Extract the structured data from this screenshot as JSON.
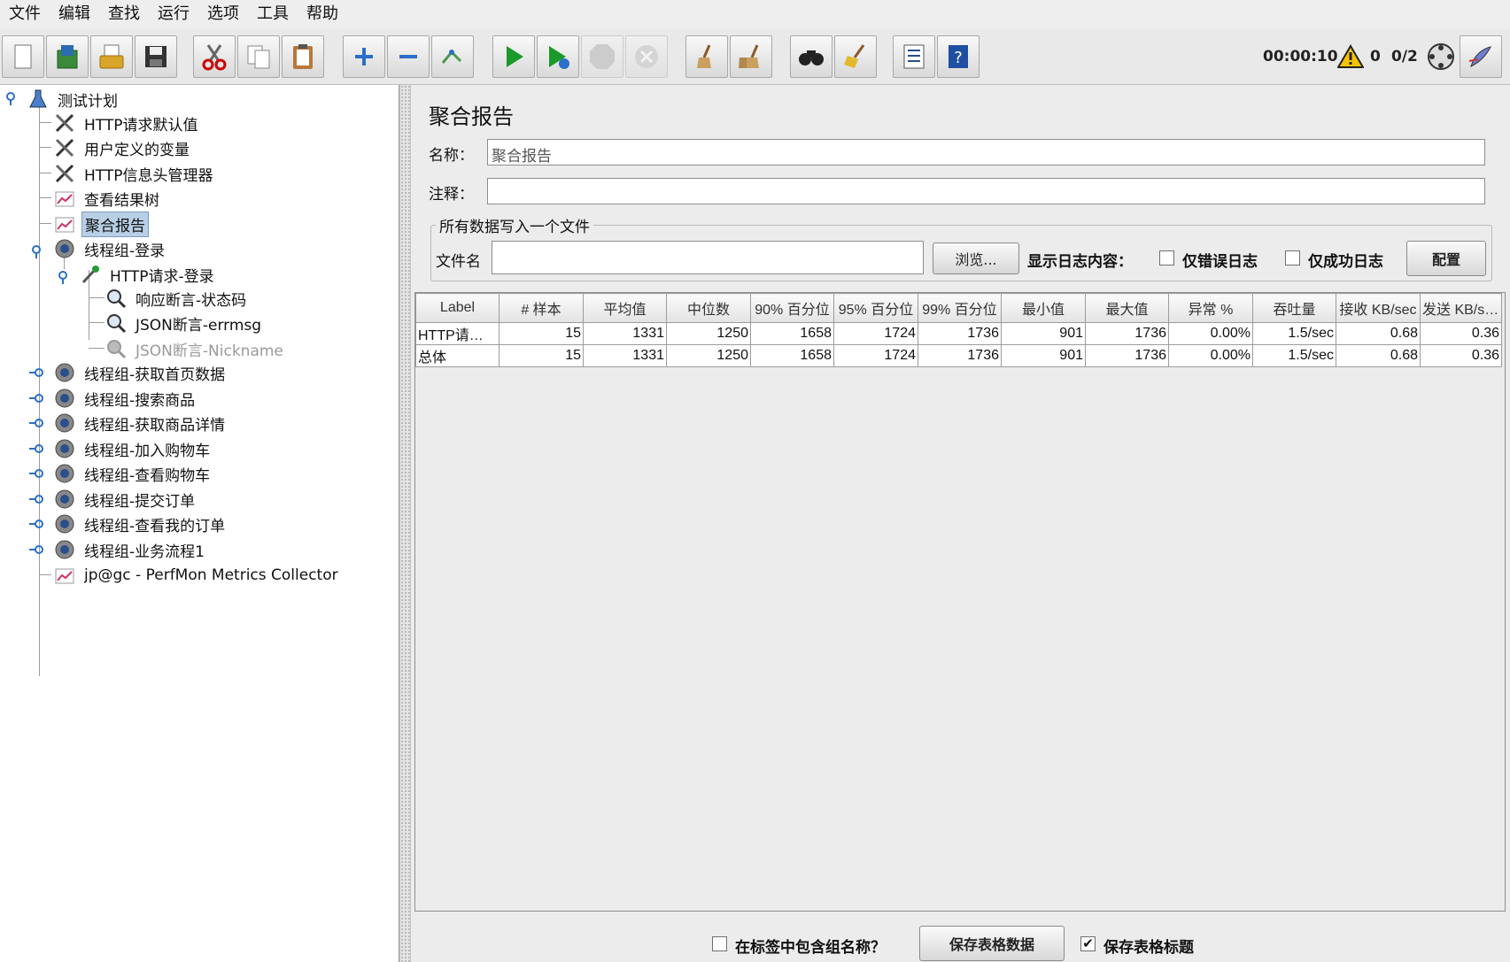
{
  "menu": [
    "文件",
    "编辑",
    "查找",
    "运行",
    "选项",
    "工具",
    "帮助"
  ],
  "toolbar": {
    "buttons": [
      {
        "name": "new-icon"
      },
      {
        "name": "templates-icon"
      },
      {
        "name": "open-icon"
      },
      {
        "name": "save-icon"
      },
      {
        "name": "cut-icon"
      },
      {
        "name": "copy-icon"
      },
      {
        "name": "paste-icon"
      },
      {
        "name": "expand-all-icon"
      },
      {
        "name": "collapse-all-icon"
      },
      {
        "name": "toggle-icon"
      },
      {
        "name": "start-icon"
      },
      {
        "name": "start-no-pause-icon"
      },
      {
        "name": "stop-icon"
      },
      {
        "name": "shutdown-icon"
      },
      {
        "name": "clear-icon"
      },
      {
        "name": "clear-all-icon"
      },
      {
        "name": "search-icon"
      },
      {
        "name": "reset-search-icon"
      },
      {
        "name": "function-helper-icon"
      },
      {
        "name": "help-icon"
      }
    ],
    "timer": "00:00:10",
    "warning_count": "0",
    "threads": "0/2"
  },
  "tree": [
    {
      "label": "测试计划",
      "icon": "test-plan-icon"
    },
    {
      "label": "HTTP请求默认值",
      "icon": "config-tools-icon"
    },
    {
      "label": "用户定义的变量",
      "icon": "config-tools-icon"
    },
    {
      "label": "HTTP信息头管理器",
      "icon": "config-tools-icon"
    },
    {
      "label": "查看结果树",
      "icon": "listener-graph-icon"
    },
    {
      "label": "聚合报告",
      "icon": "listener-graph-icon",
      "selected": true
    },
    {
      "label": "线程组-登录",
      "icon": "thread-group-icon"
    },
    {
      "label": "HTTP请求-登录",
      "icon": "sampler-pipette-icon"
    },
    {
      "label": "响应断言-状态码",
      "icon": "assertion-magnifier-icon"
    },
    {
      "label": "JSON断言-errmsg",
      "icon": "assertion-magnifier-icon"
    },
    {
      "label": "JSON断言-Nickname",
      "icon": "assertion-magnifier-icon",
      "disabled": true
    },
    {
      "label": "线程组-获取首页数据",
      "icon": "thread-group-icon"
    },
    {
      "label": "线程组-搜索商品",
      "icon": "thread-group-icon"
    },
    {
      "label": "线程组-获取商品详情",
      "icon": "thread-group-icon"
    },
    {
      "label": "线程组-加入购物车",
      "icon": "thread-group-icon"
    },
    {
      "label": "线程组-查看购物车",
      "icon": "thread-group-icon"
    },
    {
      "label": "线程组-提交订单",
      "icon": "thread-group-icon"
    },
    {
      "label": "线程组-查看我的订单",
      "icon": "thread-group-icon"
    },
    {
      "label": "线程组-业务流程1",
      "icon": "thread-group-icon"
    },
    {
      "label": "jp@gc - PerfMon Metrics Collector",
      "icon": "listener-graph-icon"
    }
  ],
  "report": {
    "title": "聚合报告",
    "name_label": "名称：",
    "name_value": "聚合报告",
    "comment_label": "注释：",
    "comment_value": "",
    "group_title": "所有数据写入一个文件",
    "filename_label": "文件名",
    "filename_value": "",
    "browse_button": "浏览...",
    "log_label": "显示日志内容：",
    "errors_only": "仅错误日志",
    "success_only": "仅成功日志",
    "configure_button": "配置"
  },
  "table": {
    "headers": [
      "Label",
      "# 样本",
      "平均值",
      "中位数",
      "90% 百分位",
      "95% 百分位",
      "99% 百分位",
      "最小值",
      "最大值",
      "异常 %",
      "吞吐量",
      "接收 KB/sec",
      "发送 KB/sec"
    ],
    "rows": [
      [
        "HTTP请求-登录",
        "15",
        "1331",
        "1250",
        "1658",
        "1724",
        "1736",
        "901",
        "1736",
        "0.00%",
        "1.5/sec",
        "0.68",
        "0.36"
      ],
      [
        "总体",
        "15",
        "1331",
        "1250",
        "1658",
        "1724",
        "1736",
        "901",
        "1736",
        "0.00%",
        "1.5/sec",
        "0.68",
        "0.36"
      ]
    ]
  },
  "footer": {
    "include_group_label": "在标签中包含组名称？",
    "include_group_checked": false,
    "save_table_button": "保存表格数据",
    "save_header_label": "保存表格标题",
    "save_header_checked": true
  }
}
